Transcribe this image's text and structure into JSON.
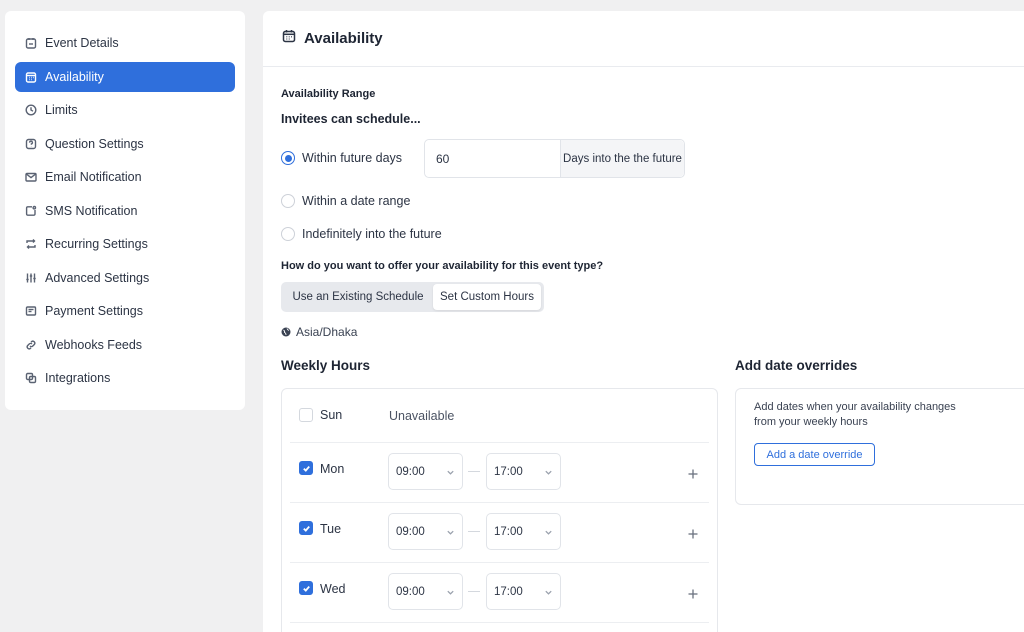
{
  "sidebar": {
    "items": [
      {
        "label": "Event Details",
        "icon": "calendar-icon"
      },
      {
        "label": "Availability",
        "icon": "calendar-grid-icon"
      },
      {
        "label": "Limits",
        "icon": "clock-icon"
      },
      {
        "label": "Question Settings",
        "icon": "question-icon"
      },
      {
        "label": "Email Notification",
        "icon": "mail-icon"
      },
      {
        "label": "SMS Notification",
        "icon": "message-icon"
      },
      {
        "label": "Recurring Settings",
        "icon": "repeat-icon"
      },
      {
        "label": "Advanced Settings",
        "icon": "sliders-icon"
      },
      {
        "label": "Payment Settings",
        "icon": "payment-icon"
      },
      {
        "label": "Webhooks Feeds",
        "icon": "link-icon"
      },
      {
        "label": "Integrations",
        "icon": "integrations-icon"
      }
    ],
    "active_color": "#2f6fdc"
  },
  "main": {
    "title": "Availability",
    "range_label": "Availability Range",
    "invitees_label": "Invitees can schedule...",
    "options": {
      "future_days": "Within future days",
      "date_range": "Within a date range",
      "indefinitely": "Indefinitely into the future"
    },
    "selected_option": "future_days",
    "days_value": "60",
    "days_suffix": "Days into the the future",
    "offer_question": "How do you want to offer your availability for this event type?",
    "schedule_modes": {
      "existing": "Use an Existing Schedule",
      "custom": "Set Custom Hours"
    },
    "selected_mode": "custom",
    "timezone": "Asia/Dhaka",
    "weekly_title": "Weekly Hours",
    "unavailable_text": "Unavailable",
    "days": [
      {
        "name": "Sun",
        "checked": false
      },
      {
        "name": "Mon",
        "checked": true,
        "start": "09:00",
        "end": "17:00"
      },
      {
        "name": "Tue",
        "checked": true,
        "start": "09:00",
        "end": "17:00"
      },
      {
        "name": "Wed",
        "checked": true,
        "start": "09:00",
        "end": "17:00"
      }
    ],
    "overrides_title": "Add date overrides",
    "overrides_text": "Add dates when your availability changes from your weekly hours",
    "overrides_button": "Add a date override"
  }
}
